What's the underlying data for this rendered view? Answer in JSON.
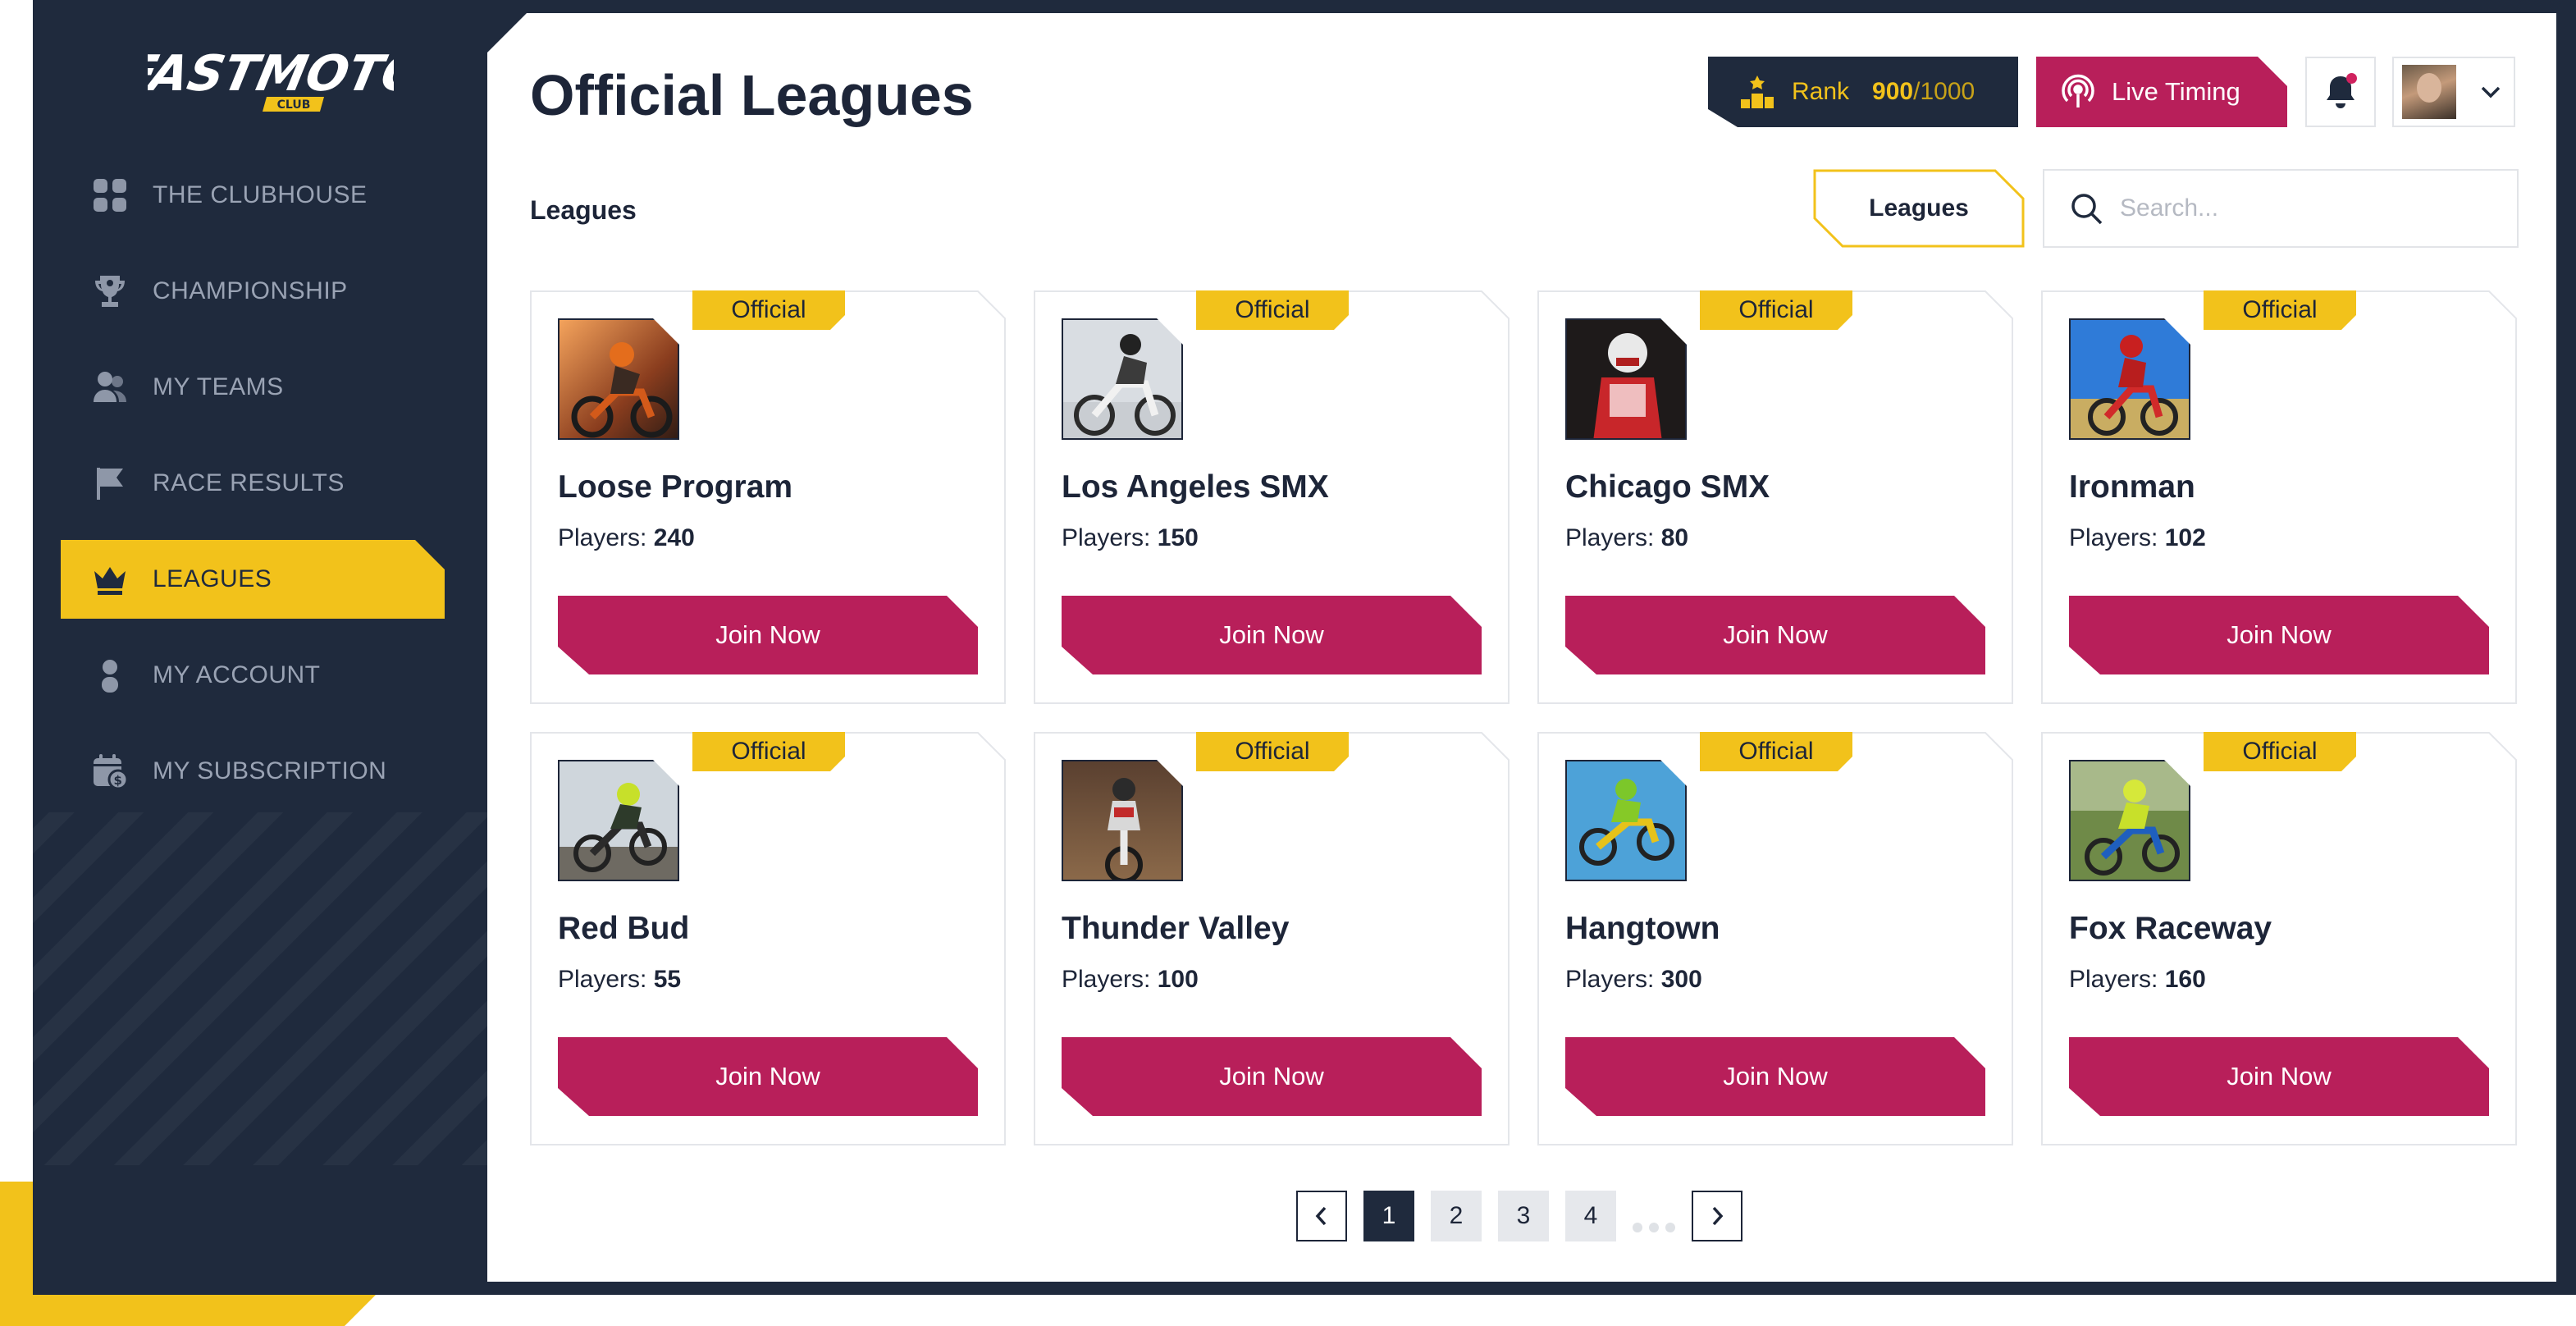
{
  "app": {
    "logo_text": "FASTMOTO",
    "logo_sub": "CLUB"
  },
  "colors": {
    "navy": "#1f2a3d",
    "accent_yellow": "#f2c21b",
    "accent_magenta": "#b81f5a"
  },
  "sidebar": {
    "items": [
      {
        "label": "THE CLUBHOUSE",
        "icon": "grid-icon",
        "active": false
      },
      {
        "label": "CHAMPIONSHIP",
        "icon": "trophy-icon",
        "active": false
      },
      {
        "label": "MY TEAMS",
        "icon": "users-icon",
        "active": false
      },
      {
        "label": "RACE RESULTS",
        "icon": "flag-icon",
        "active": false
      },
      {
        "label": "LEAGUES",
        "icon": "crown-icon",
        "active": true
      },
      {
        "label": "MY ACCOUNT",
        "icon": "user-icon",
        "active": false
      },
      {
        "label": "MY SUBSCRIPTION",
        "icon": "calendar-dollar-icon",
        "active": false
      }
    ]
  },
  "header": {
    "title": "Official Leagues",
    "rank": {
      "label": "Rank",
      "value": "900",
      "max": "/1000"
    },
    "live_timing_label": "Live Timing"
  },
  "toolbar": {
    "section_label": "Leagues",
    "tab_label": "Leagues",
    "search_placeholder": "Search..."
  },
  "leagues": [
    {
      "name": "Loose Program",
      "players_label": "Players:",
      "players": "240",
      "badge": "Official",
      "button": "Join Now"
    },
    {
      "name": "Los Angeles SMX",
      "players_label": "Players:",
      "players": "150",
      "badge": "Official",
      "button": "Join Now"
    },
    {
      "name": "Chicago SMX",
      "players_label": "Players:",
      "players": "80",
      "badge": "Official",
      "button": "Join Now"
    },
    {
      "name": "Ironman",
      "players_label": "Players:",
      "players": "102",
      "badge": "Official",
      "button": "Join Now"
    },
    {
      "name": "Red Bud",
      "players_label": "Players:",
      "players": "55",
      "badge": "Official",
      "button": "Join Now"
    },
    {
      "name": "Thunder Valley",
      "players_label": "Players:",
      "players": "100",
      "badge": "Official",
      "button": "Join Now"
    },
    {
      "name": "Hangtown",
      "players_label": "Players:",
      "players": "300",
      "badge": "Official",
      "button": "Join Now"
    },
    {
      "name": "Fox Raceway",
      "players_label": "Players:",
      "players": "160",
      "badge": "Official",
      "button": "Join Now"
    }
  ],
  "pagination": {
    "pages": [
      "1",
      "2",
      "3",
      "4"
    ],
    "current": "1"
  }
}
